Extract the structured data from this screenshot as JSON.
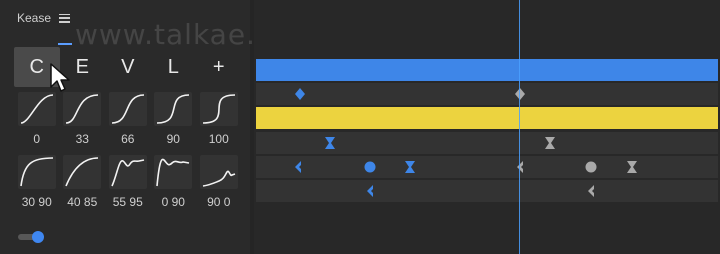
{
  "app": {
    "title": "Kease",
    "menu_icon": "hamburger-menu-icon"
  },
  "watermark": "www.talkae.com",
  "tabs": [
    {
      "label": "C",
      "active": true
    },
    {
      "label": "E",
      "active": false
    },
    {
      "label": "V",
      "active": false
    },
    {
      "label": "L",
      "active": false
    },
    {
      "label": "+",
      "active": false
    }
  ],
  "presets": {
    "row1": [
      {
        "label": "0",
        "curve": "ease-0"
      },
      {
        "label": "33",
        "curve": "ease-33"
      },
      {
        "label": "66",
        "curve": "ease-66"
      },
      {
        "label": "90",
        "curve": "ease-90"
      },
      {
        "label": "100",
        "curve": "ease-100"
      }
    ],
    "row2": [
      {
        "label": "30 90",
        "curve": "ease-30-90"
      },
      {
        "label": "40 85",
        "curve": "ease-40-85"
      },
      {
        "label": "55 95",
        "curve": "overshoot-55-95"
      },
      {
        "label": "0 90",
        "curve": "overshoot-0-90"
      },
      {
        "label": "90 0",
        "curve": "overshoot-90-0"
      }
    ]
  },
  "toggle": {
    "state": "on"
  },
  "timeline": {
    "colors": {
      "blue_layer": "#3e86e8",
      "yellow_layer": "#ecd33f",
      "keyframe_selected": "#3e86e8",
      "keyframe_unselected": "#a9a9a9",
      "playhead": "#4aa0ff"
    },
    "rows": [
      {
        "type": "layer-bar",
        "color": "blue"
      },
      {
        "type": "keyframes",
        "keys": [
          {
            "shape": "diamond",
            "selected": true
          },
          {
            "shape": "diamond",
            "selected": false
          }
        ]
      },
      {
        "type": "layer-bar",
        "color": "yellow"
      },
      {
        "type": "keyframes",
        "keys": [
          {
            "shape": "hourglass",
            "selected": true
          },
          {
            "shape": "hourglass",
            "selected": false
          }
        ]
      },
      {
        "type": "keyframes",
        "keys": [
          {
            "shape": "ease-in",
            "selected": true
          },
          {
            "shape": "circle",
            "selected": true
          },
          {
            "shape": "hourglass",
            "selected": true
          },
          {
            "shape": "ease-in",
            "selected": false
          },
          {
            "shape": "circle",
            "selected": false
          },
          {
            "shape": "hourglass",
            "selected": false
          }
        ]
      },
      {
        "type": "keyframes",
        "keys": [
          {
            "shape": "ease-in",
            "selected": true
          },
          {
            "shape": "ease-in",
            "selected": false
          }
        ]
      }
    ]
  }
}
